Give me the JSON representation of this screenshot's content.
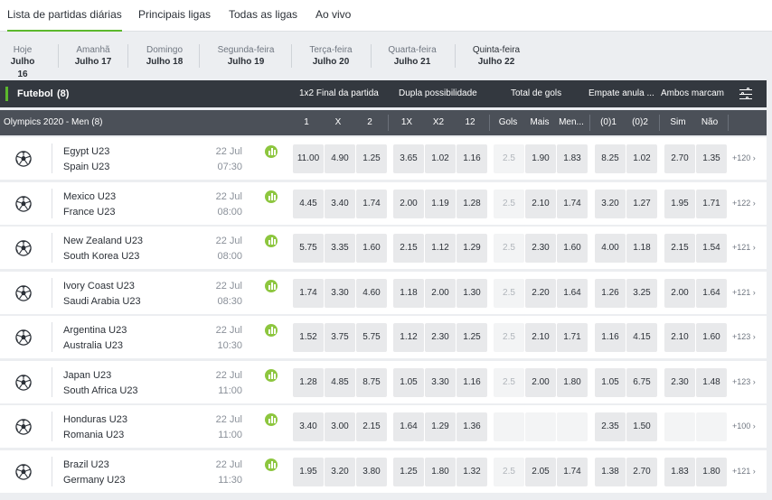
{
  "tabs": [
    "Lista de partidas diárias",
    "Principais ligas",
    "Todas as ligas",
    "Ao vivo"
  ],
  "days": [
    {
      "name": "Hoje",
      "date": "Julho 16"
    },
    {
      "name": "Amanhã",
      "date": "Julho 17"
    },
    {
      "name": "Domingo",
      "date": "Julho 18"
    },
    {
      "name": "Segunda-feira",
      "date": "Julho 19"
    },
    {
      "name": "Terça-feira",
      "date": "Julho 20"
    },
    {
      "name": "Quarta-feira",
      "date": "Julho 21"
    },
    {
      "name": "Quinta-feira",
      "date": "Julho 22"
    }
  ],
  "sport": {
    "title": "Futebol",
    "count": "(8)",
    "markets": [
      "1x2 Final da partida",
      "Dupla possibilidade",
      "Total de gols",
      "Empate anula ...",
      "Ambos marcam"
    ]
  },
  "league": {
    "name": "Olympics 2020 - Men (8)",
    "columns": [
      "1",
      "X",
      "2",
      "1X",
      "X2",
      "12",
      "Gols",
      "Mais",
      "Men...",
      "(0)1",
      "(0)2",
      "Sim",
      "Não"
    ]
  },
  "matches": [
    {
      "home": "Egypt U23",
      "away": "Spain U23",
      "date": "22 Jul",
      "time": "07:30",
      "odds": [
        "11.00",
        "4.90",
        "1.25",
        "3.65",
        "1.02",
        "1.16",
        "2.5",
        "1.90",
        "1.83",
        "8.25",
        "1.02",
        "2.70",
        "1.35"
      ],
      "more": "+120 ›"
    },
    {
      "home": "Mexico U23",
      "away": "France U23",
      "date": "22 Jul",
      "time": "08:00",
      "odds": [
        "4.45",
        "3.40",
        "1.74",
        "2.00",
        "1.19",
        "1.28",
        "2.5",
        "2.10",
        "1.74",
        "3.20",
        "1.27",
        "1.95",
        "1.71"
      ],
      "more": "+122 ›"
    },
    {
      "home": "New Zealand U23",
      "away": "South Korea U23",
      "date": "22 Jul",
      "time": "08:00",
      "odds": [
        "5.75",
        "3.35",
        "1.60",
        "2.15",
        "1.12",
        "1.29",
        "2.5",
        "2.30",
        "1.60",
        "4.00",
        "1.18",
        "2.15",
        "1.54"
      ],
      "more": "+121 ›"
    },
    {
      "home": "Ivory Coast U23",
      "away": "Saudi Arabia U23",
      "date": "22 Jul",
      "time": "08:30",
      "odds": [
        "1.74",
        "3.30",
        "4.60",
        "1.18",
        "2.00",
        "1.30",
        "2.5",
        "2.20",
        "1.64",
        "1.26",
        "3.25",
        "2.00",
        "1.64"
      ],
      "more": "+121 ›"
    },
    {
      "home": "Argentina U23",
      "away": "Australia U23",
      "date": "22 Jul",
      "time": "10:30",
      "odds": [
        "1.52",
        "3.75",
        "5.75",
        "1.12",
        "2.30",
        "1.25",
        "2.5",
        "2.10",
        "1.71",
        "1.16",
        "4.15",
        "2.10",
        "1.60"
      ],
      "more": "+123 ›"
    },
    {
      "home": "Japan U23",
      "away": "South Africa U23",
      "date": "22 Jul",
      "time": "11:00",
      "odds": [
        "1.28",
        "4.85",
        "8.75",
        "1.05",
        "3.30",
        "1.16",
        "2.5",
        "2.00",
        "1.80",
        "1.05",
        "6.75",
        "2.30",
        "1.48"
      ],
      "more": "+123 ›"
    },
    {
      "home": "Honduras U23",
      "away": "Romania U23",
      "date": "22 Jul",
      "time": "11:00",
      "odds": [
        "3.40",
        "3.00",
        "2.15",
        "1.64",
        "1.29",
        "1.36",
        "",
        "",
        "",
        "2.35",
        "1.50",
        "",
        ""
      ],
      "more": "+100 ›"
    },
    {
      "home": "Brazil U23",
      "away": "Germany U23",
      "date": "22 Jul",
      "time": "11:30",
      "odds": [
        "1.95",
        "3.20",
        "3.80",
        "1.25",
        "1.80",
        "1.32",
        "2.5",
        "2.05",
        "1.74",
        "1.38",
        "2.70",
        "1.83",
        "1.80"
      ],
      "more": "+121 ›"
    }
  ],
  "colors": {
    "accent": "#5cb82d",
    "header_dark": "#33383f",
    "header_league": "#4b5058",
    "stats_icon": "#8dc63f"
  },
  "icons": {
    "ball": "soccer-ball-icon",
    "stats": "stats-icon",
    "filter": "filter-settings-icon"
  }
}
